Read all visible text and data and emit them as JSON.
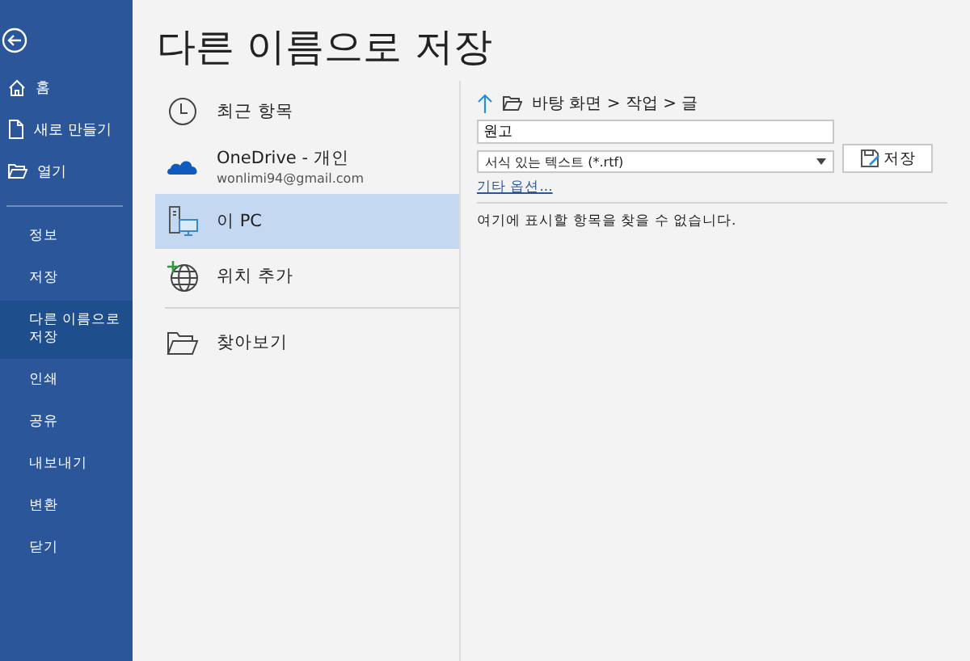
{
  "sidebar": {
    "top_items": [
      {
        "label": "홈",
        "selected": false
      },
      {
        "label": "새로 만들기",
        "selected": false
      },
      {
        "label": "열기",
        "selected": false
      }
    ],
    "items": [
      {
        "label": "정보",
        "selected": false
      },
      {
        "label": "저장",
        "selected": false
      },
      {
        "label": "다른 이름으로 저장",
        "selected": true
      },
      {
        "label": "인쇄",
        "selected": false
      },
      {
        "label": "공유",
        "selected": false
      },
      {
        "label": "내보내기",
        "selected": false
      },
      {
        "label": "변환",
        "selected": false
      },
      {
        "label": "닫기",
        "selected": false
      }
    ]
  },
  "title": "다른 이름으로 저장",
  "places": [
    {
      "kind": "recent",
      "label": "최근 항목",
      "selected": false
    },
    {
      "kind": "onedrive",
      "label": "OneDrive - 개인",
      "subtitle": "wonlimi94@gmail.com",
      "selected": false
    },
    {
      "kind": "pc",
      "label": "이 PC",
      "selected": true
    },
    {
      "kind": "add",
      "label": "위치 추가",
      "selected": false
    },
    {
      "kind": "browse",
      "label": "찾아보기",
      "selected": false
    }
  ],
  "save_panel": {
    "path": "바탕 화면 > 작업 > 글",
    "file_name": "원고",
    "file_type": "서식 있는 텍스트 (*.rtf)",
    "save_button": "저장",
    "more_options": "기타 옵션...",
    "empty_message": "여기에 표시할 항목을 찾을 수 없습니다."
  }
}
